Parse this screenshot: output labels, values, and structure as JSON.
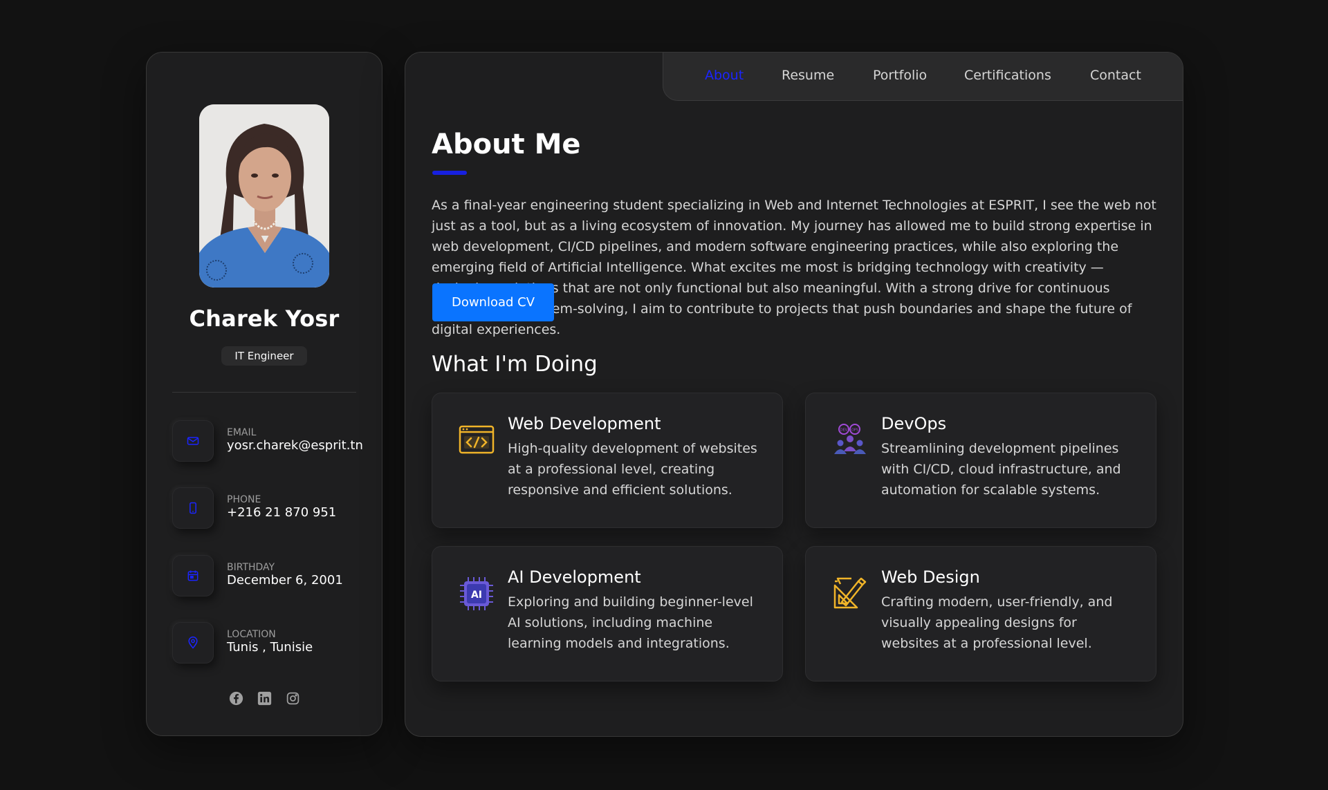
{
  "profile": {
    "name": "Charek Yosr",
    "role": "IT Engineer"
  },
  "contacts": [
    {
      "label": "Email",
      "value": "yosr.charek@esprit.tn",
      "icon": "mail-icon"
    },
    {
      "label": "Phone",
      "value": "+216 21 870 951",
      "icon": "phone-icon"
    },
    {
      "label": "Birthday",
      "value": "December 6, 2001",
      "icon": "calendar-icon"
    },
    {
      "label": "Location",
      "value": "Tunis , Tunisie",
      "icon": "location-pin-icon"
    }
  ],
  "socials": [
    "facebook-icon",
    "linkedin-icon",
    "instagram-icon"
  ],
  "nav": {
    "items": [
      "About",
      "Resume",
      "Portfolio",
      "Certifications",
      "Contact"
    ],
    "active": "About"
  },
  "about": {
    "title": "About Me",
    "text": "As a final-year engineering student specializing in Web and Internet Technologies at ESPRIT, I see the web not just as a tool, but as a living ecosystem of innovation. My journey has allowed me to build strong expertise in web development, CI/CD pipelines, and modern software engineering practices, while also exploring the emerging field of Artificial Intelligence. What excites me most is bridging technology with creativity — designing solutions that are not only functional but also meaningful. With a strong drive for continuous learning and problem-solving, I aim to contribute to projects that push boundaries and shape the future of digital experiences.",
    "cv_button": "Download CV"
  },
  "services": {
    "title": "What I'm Doing",
    "items": [
      {
        "title": "Web Development",
        "text": "High-quality development of websites at a professional level, creating responsive and efficient solutions.",
        "icon": "code-window-icon"
      },
      {
        "title": "DevOps",
        "text": "Streamlining development pipelines with CI/CD, cloud infrastructure, and automation for scalable systems.",
        "icon": "devops-team-icon"
      },
      {
        "title": "AI Development",
        "text": "Exploring and building beginner-level AI solutions, including machine learning models and integrations.",
        "icon": "ai-chip-icon"
      },
      {
        "title": "Web Design",
        "text": "Crafting modern, user-friendly, and visually appealing designs for websites at a professional level.",
        "icon": "design-tools-icon"
      }
    ]
  },
  "colors": {
    "accent": "#1b24ff",
    "button": "#0a74ff",
    "background": "#121212",
    "card": "#1e1e1f"
  }
}
